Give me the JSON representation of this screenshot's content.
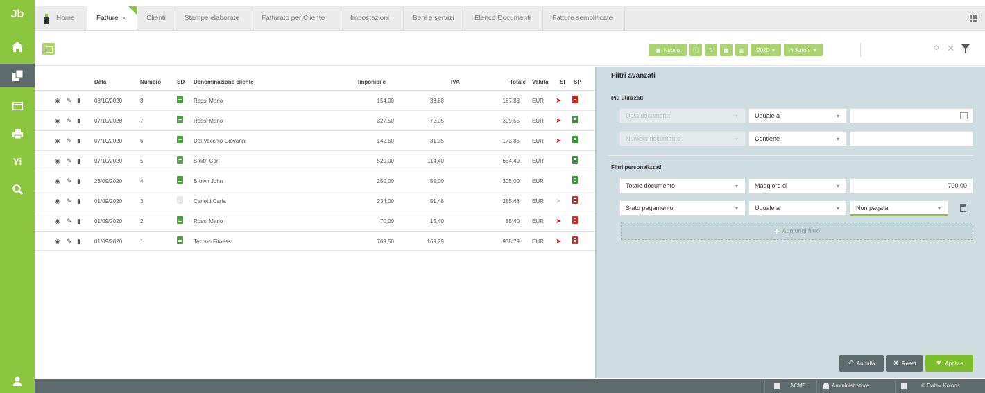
{
  "colors": {
    "accent": "#8cc63f",
    "dark": "#5d6b6c",
    "panel": "#cfdde0",
    "sent_red": "#dd1111",
    "doc_green": "#4aa33a"
  },
  "rail": {
    "icons": [
      "logo-icon",
      "home-icon",
      "documents-icon",
      "table-icon",
      "printer-icon",
      "tools-icon",
      "search-icon",
      "user-icon"
    ],
    "logo_text": "Jb"
  },
  "tabs": [
    {
      "label": "Home"
    },
    {
      "label": "Fatture",
      "active": true,
      "closable": true
    },
    {
      "label": "Clienti"
    },
    {
      "label": "Stampe elaborate"
    },
    {
      "label": "Fatturato per Cliente"
    },
    {
      "label": "Impostazioni"
    },
    {
      "label": "Beni e servizi"
    },
    {
      "label": "Elenco Documenti"
    },
    {
      "label": "Fatture semplificate"
    }
  ],
  "toolbar": {
    "new_label": "Nuovo",
    "year_label": "2020",
    "actions_label": "Azioni"
  },
  "table": {
    "headers": {
      "data": "Data",
      "numero": "Numero",
      "sd": "SD",
      "cliente": "Denominazione cliente",
      "imponibile": "Imponibile",
      "iva": "IVA",
      "totale": "Totale",
      "valuta": "Valuta",
      "si": "SI",
      "sp": "SP"
    },
    "rows": [
      {
        "data": "08/10/2020",
        "numero": "8",
        "cliente": "Rossi Mario",
        "imponibile": "154,00",
        "iva": "33,88",
        "totale": "187,88",
        "valuta": "EUR",
        "sent": "red",
        "sp": "red",
        "doc": "green"
      },
      {
        "data": "07/10/2020",
        "numero": "7",
        "cliente": "Rossi Mario",
        "imponibile": "327,50",
        "iva": "72,05",
        "totale": "399,55",
        "valuta": "EUR",
        "sent": "red",
        "sp": "green",
        "doc": "green"
      },
      {
        "data": "07/10/2020",
        "numero": "6",
        "cliente": "Del Vecchio Giovanni",
        "imponibile": "142,50",
        "iva": "31,35",
        "totale": "173,85",
        "valuta": "EUR",
        "sent": "red",
        "sp": "green",
        "doc": "green"
      },
      {
        "data": "07/10/2020",
        "numero": "5",
        "cliente": "Smith Carl",
        "imponibile": "520,00",
        "iva": "114,40",
        "totale": "634,40",
        "valuta": "EUR",
        "sent": "none",
        "sp": "green",
        "doc": "green"
      },
      {
        "data": "23/09/2020",
        "numero": "4",
        "cliente": "Brown John",
        "imponibile": "250,00",
        "iva": "55,00",
        "totale": "305,00",
        "valuta": "EUR",
        "sent": "none",
        "sp": "green",
        "doc": "green"
      },
      {
        "data": "01/09/2020",
        "numero": "3",
        "cliente": "Carletti Carla",
        "imponibile": "234,00",
        "iva": "51,48",
        "totale": "285,48",
        "valuta": "EUR",
        "sent": "gray",
        "sp": "red",
        "doc": "gray"
      },
      {
        "data": "01/09/2020",
        "numero": "2",
        "cliente": "Rossi Mario",
        "imponibile": "70,00",
        "iva": "15,40",
        "totale": "85,40",
        "valuta": "EUR",
        "sent": "red",
        "sp": "red",
        "doc": "green"
      },
      {
        "data": "01/09/2020",
        "numero": "1",
        "cliente": "Techno Fitness",
        "imponibile": "769,50",
        "iva": "169,29",
        "totale": "938,79",
        "valuta": "EUR",
        "sent": "red",
        "sp": "red",
        "doc": "green"
      }
    ]
  },
  "filters": {
    "title": "Filtri avanzati",
    "most_used_label": "Più utilizzati",
    "custom_label": "Filtri personalizzati",
    "most_used": [
      {
        "field": "Data documento",
        "operator": "Uguale a",
        "value": ""
      },
      {
        "field": "Numero documento",
        "operator": "Contiene",
        "value": ""
      }
    ],
    "custom": [
      {
        "field": "Totale documento",
        "operator": "Maggiore di",
        "value": "700,00"
      },
      {
        "field": "Stato pagamento",
        "operator": "Uguale a",
        "value": "Non pagata"
      }
    ],
    "add_label": "Aggiungi filtro",
    "cancel_label": "Annulla",
    "reset_label": "Reset",
    "apply_label": "Applica"
  },
  "status": {
    "company": "ACME",
    "user": "Amministratore",
    "copyright": "© Datev Koinos"
  }
}
